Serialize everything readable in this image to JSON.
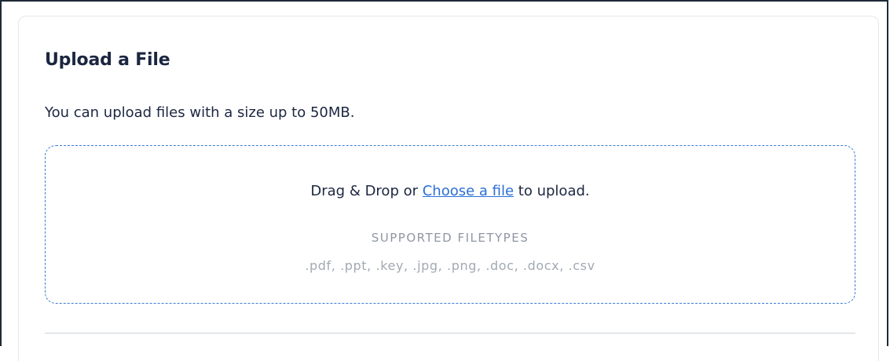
{
  "upload": {
    "title": "Upload a File",
    "description": "You can upload files with a size up to 50MB."
  },
  "dropzone": {
    "prefix": "Drag & Drop or ",
    "link_label": "Choose a file",
    "suffix": " to upload.",
    "filetypes_heading": "SUPPORTED FILETYPES",
    "filetypes_list": ".pdf, .ppt, .key, .jpg, .png, .doc, .docx, .csv"
  },
  "colors": {
    "text": "#1b2640",
    "link": "#2b6fd6",
    "dropzone_border": "#3b7bd4",
    "muted": "#8e97a3"
  }
}
